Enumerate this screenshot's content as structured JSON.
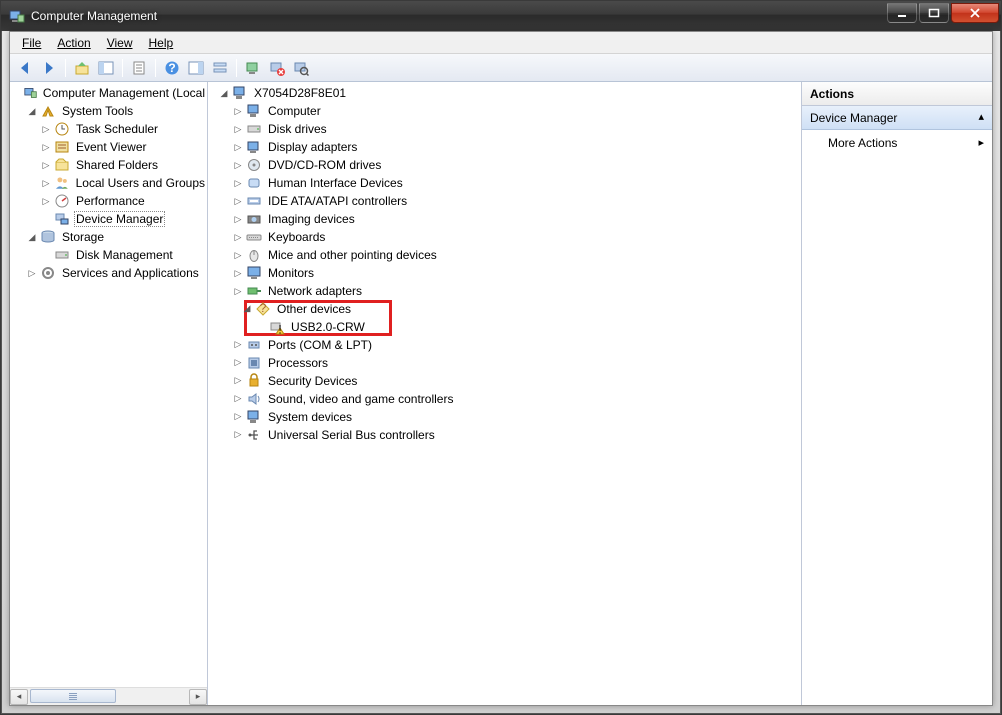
{
  "window": {
    "title": "Computer Management"
  },
  "menu": {
    "file": "File",
    "action": "Action",
    "view": "View",
    "help": "Help"
  },
  "left_tree": {
    "root": "Computer Management (Local",
    "system_tools": "System Tools",
    "task_scheduler": "Task Scheduler",
    "event_viewer": "Event Viewer",
    "shared_folders": "Shared Folders",
    "local_users": "Local Users and Groups",
    "performance": "Performance",
    "device_manager": "Device Manager",
    "storage": "Storage",
    "disk_management": "Disk Management",
    "services_apps": "Services and Applications"
  },
  "mid_tree": {
    "host": "X7054D28F8E01",
    "items": [
      "Computer",
      "Disk drives",
      "Display adapters",
      "DVD/CD-ROM drives",
      "Human Interface Devices",
      "IDE ATA/ATAPI controllers",
      "Imaging devices",
      "Keyboards",
      "Mice and other pointing devices",
      "Monitors",
      "Network adapters",
      "Other devices",
      "Ports (COM & LPT)",
      "Processors",
      "Security Devices",
      "Sound, video and game controllers",
      "System devices",
      "Universal Serial Bus controllers"
    ],
    "other_child": "USB2.0-CRW"
  },
  "actions": {
    "header": "Actions",
    "section": "Device Manager",
    "more": "More Actions"
  }
}
